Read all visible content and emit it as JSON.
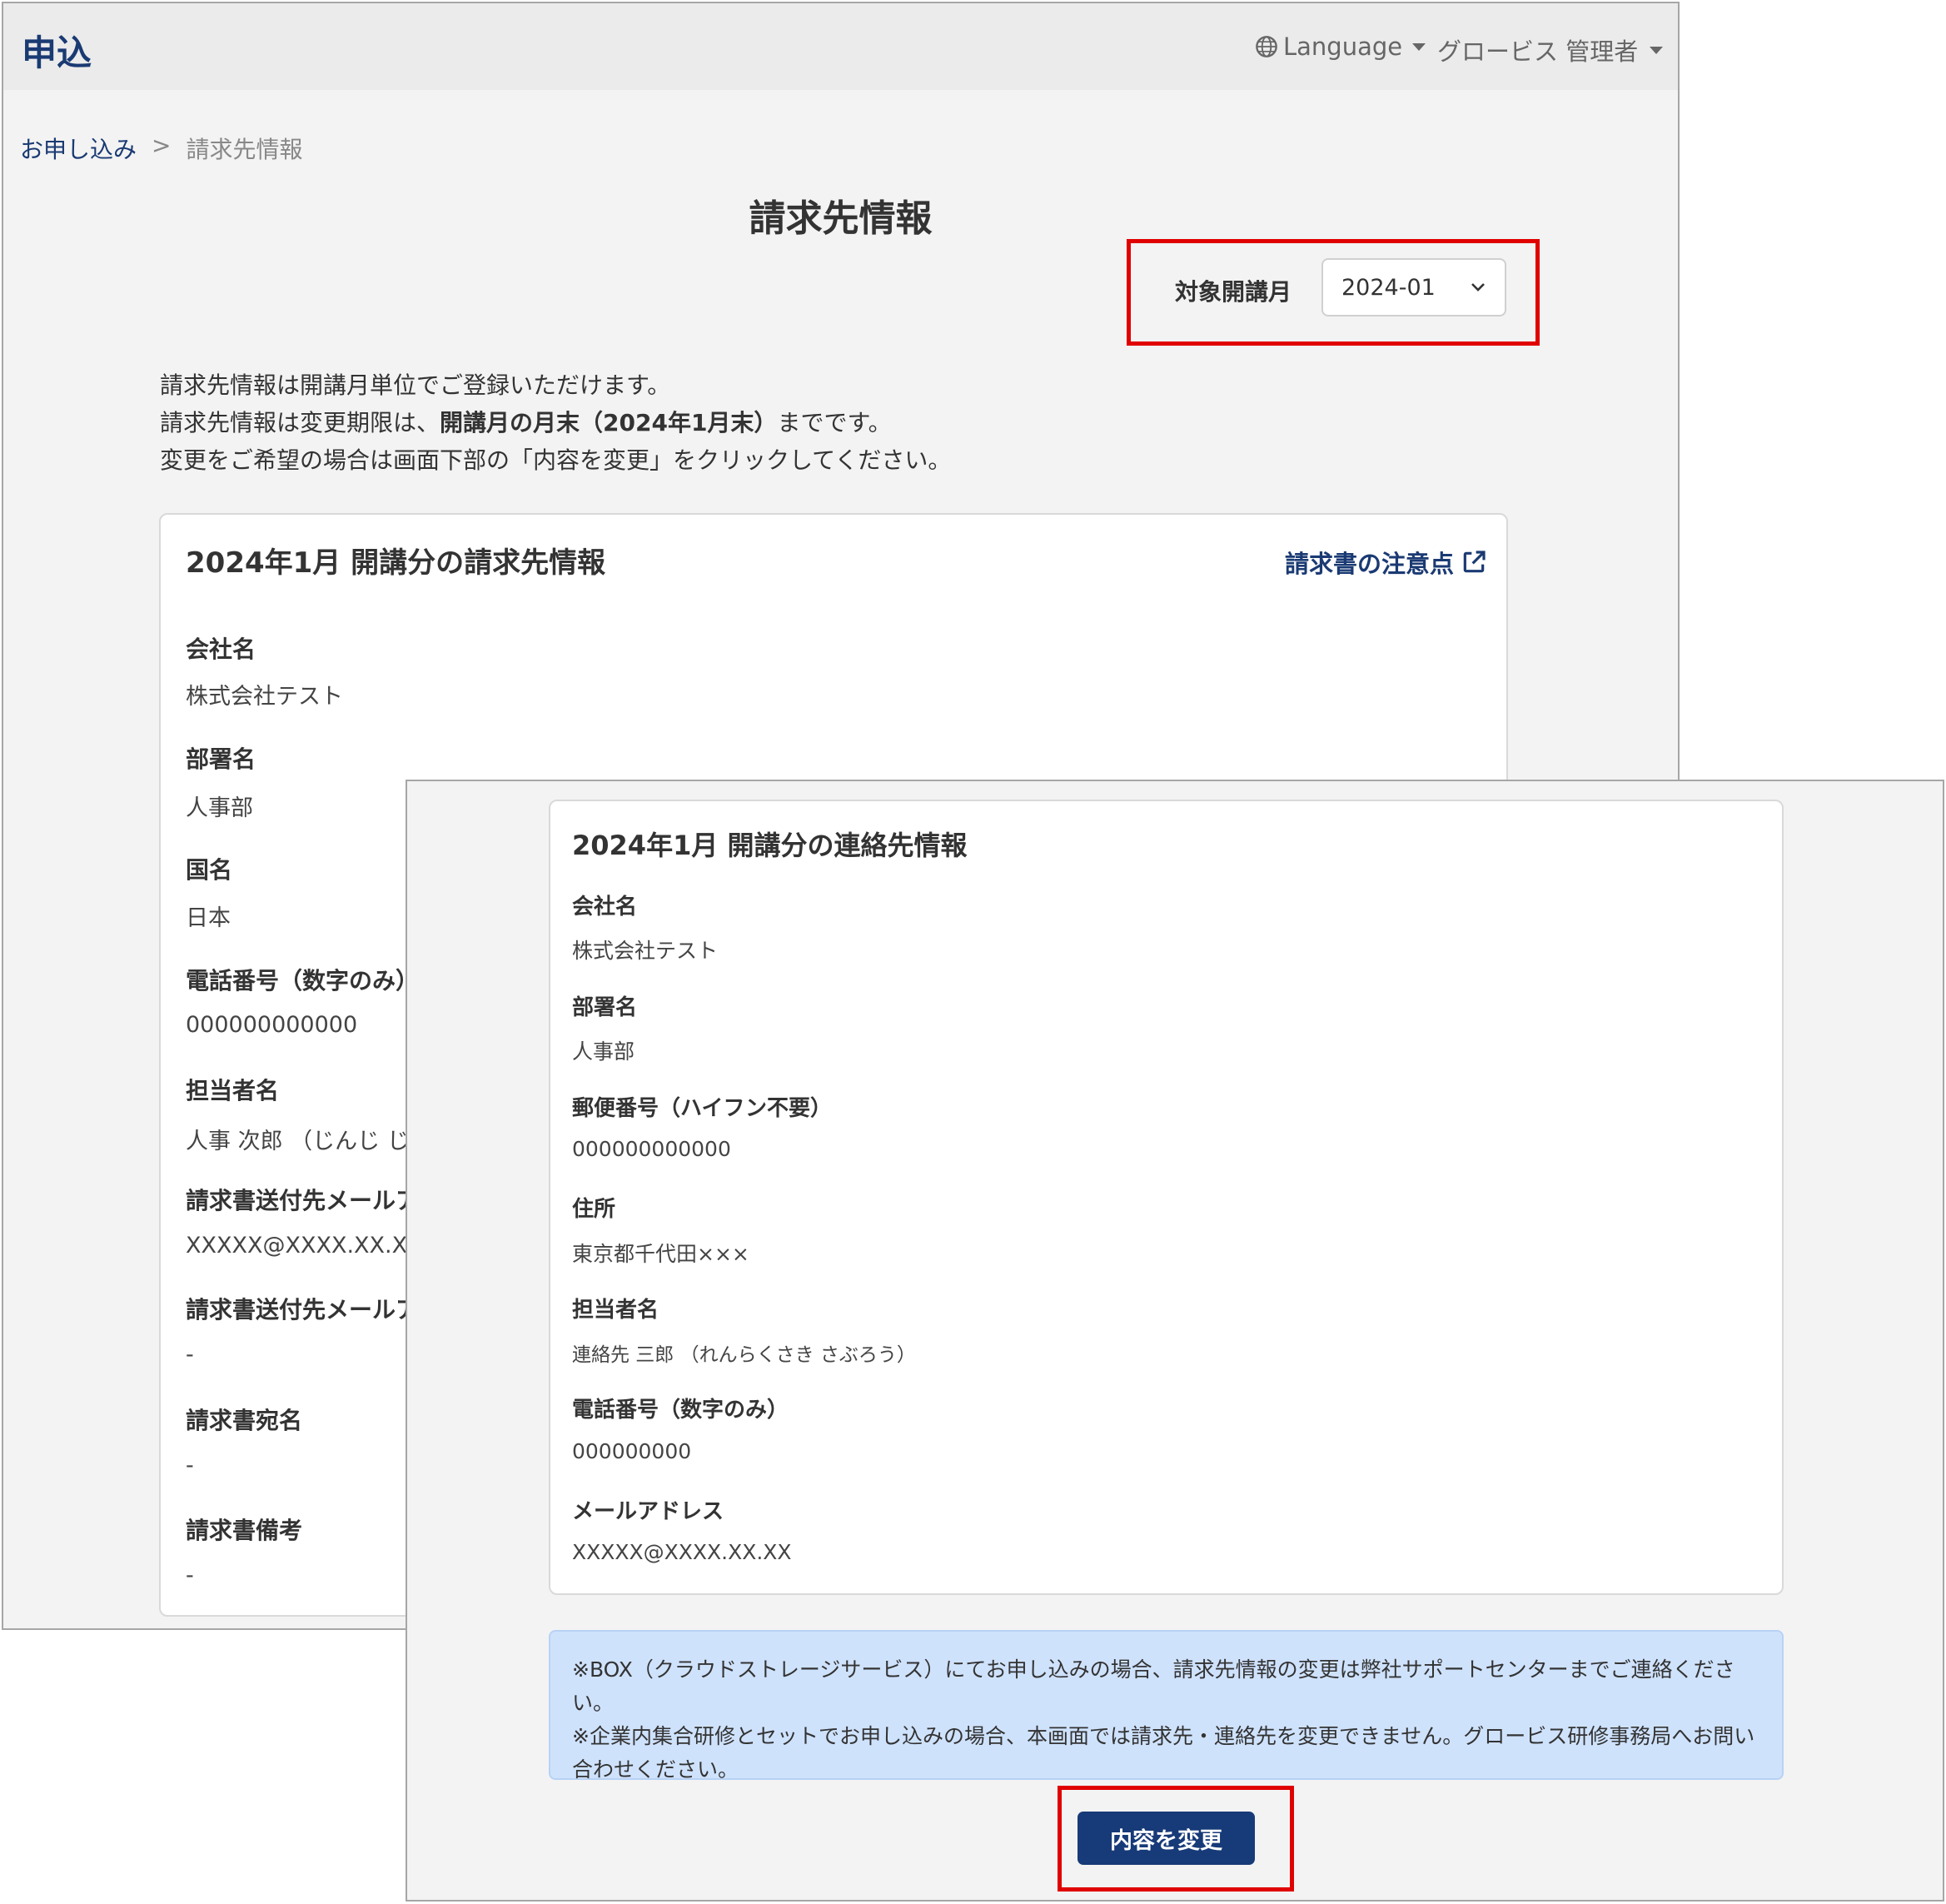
{
  "header": {
    "brand": "申込",
    "language_label": "Language",
    "user_label": "グロービス 管理者"
  },
  "breadcrumb": {
    "parent": "お申し込み",
    "separator": ">",
    "current": "請求先情報"
  },
  "page_title": "請求先情報",
  "month_selector": {
    "label": "対象開講月",
    "value": "2024-01"
  },
  "intro": {
    "line1": "請求先情報は開講月単位でご登録いただけます。",
    "line2_pre": "請求先情報は変更期限は、",
    "line2_bold": "開講月の月末（2024年1月末）",
    "line2_post": "までです。",
    "line3": "変更をご希望の場合は画面下部の「内容を変更」をクリックしてください。"
  },
  "billing_card": {
    "title": "2024年1月 開講分の請求先情報",
    "notice_link": "請求書の注意点",
    "fields": [
      {
        "label": "会社名",
        "value": "株式会社テスト"
      },
      {
        "label": "部署名",
        "value": "人事部"
      },
      {
        "label": "国名",
        "value": "日本"
      },
      {
        "label": "電話番号（数字のみ）",
        "value": "000000000000"
      },
      {
        "label": "担当者名",
        "value": "人事 次郎 （じんじ じろ"
      },
      {
        "label": "請求書送付先メールア",
        "value": "XXXXX@XXXX.XX.XX"
      },
      {
        "label": "請求書送付先メールア",
        "value": "-"
      },
      {
        "label": "請求書宛名",
        "value": "-"
      },
      {
        "label": "請求書備考",
        "value": "-"
      }
    ]
  },
  "contact_card": {
    "title": "2024年1月 開講分の連絡先情報",
    "fields": [
      {
        "label": "会社名",
        "value": "株式会社テスト"
      },
      {
        "label": "部署名",
        "value": "人事部"
      },
      {
        "label": "郵便番号（ハイフン不要）",
        "value": "000000000000"
      },
      {
        "label": "住所",
        "value": "東京都千代田×××"
      },
      {
        "label": "担当者名",
        "value": "連絡先 三郎 （れんらくさき さぶろう）"
      },
      {
        "label": "電話番号（数字のみ）",
        "value": "000000000"
      },
      {
        "label": "メールアドレス",
        "value": "XXXXX@XXXX.XX.XX"
      }
    ]
  },
  "info_box": {
    "line1": "※BOX（クラウドストレージサービス）にてお申し込みの場合、請求先情報の変更は弊社サポートセンターまでご連絡ください。",
    "line2": "※企業内集合研修とセットでお申し込みの場合、本画面では請求先・連絡先を変更できません。グロービス研修事務局へお問い",
    "line3": "合わせください。"
  },
  "change_button": "内容を変更",
  "colors": {
    "brand": "#1a3a73",
    "button": "#173a78",
    "highlight": "#e00000",
    "info_bg": "#cfe2fc"
  }
}
